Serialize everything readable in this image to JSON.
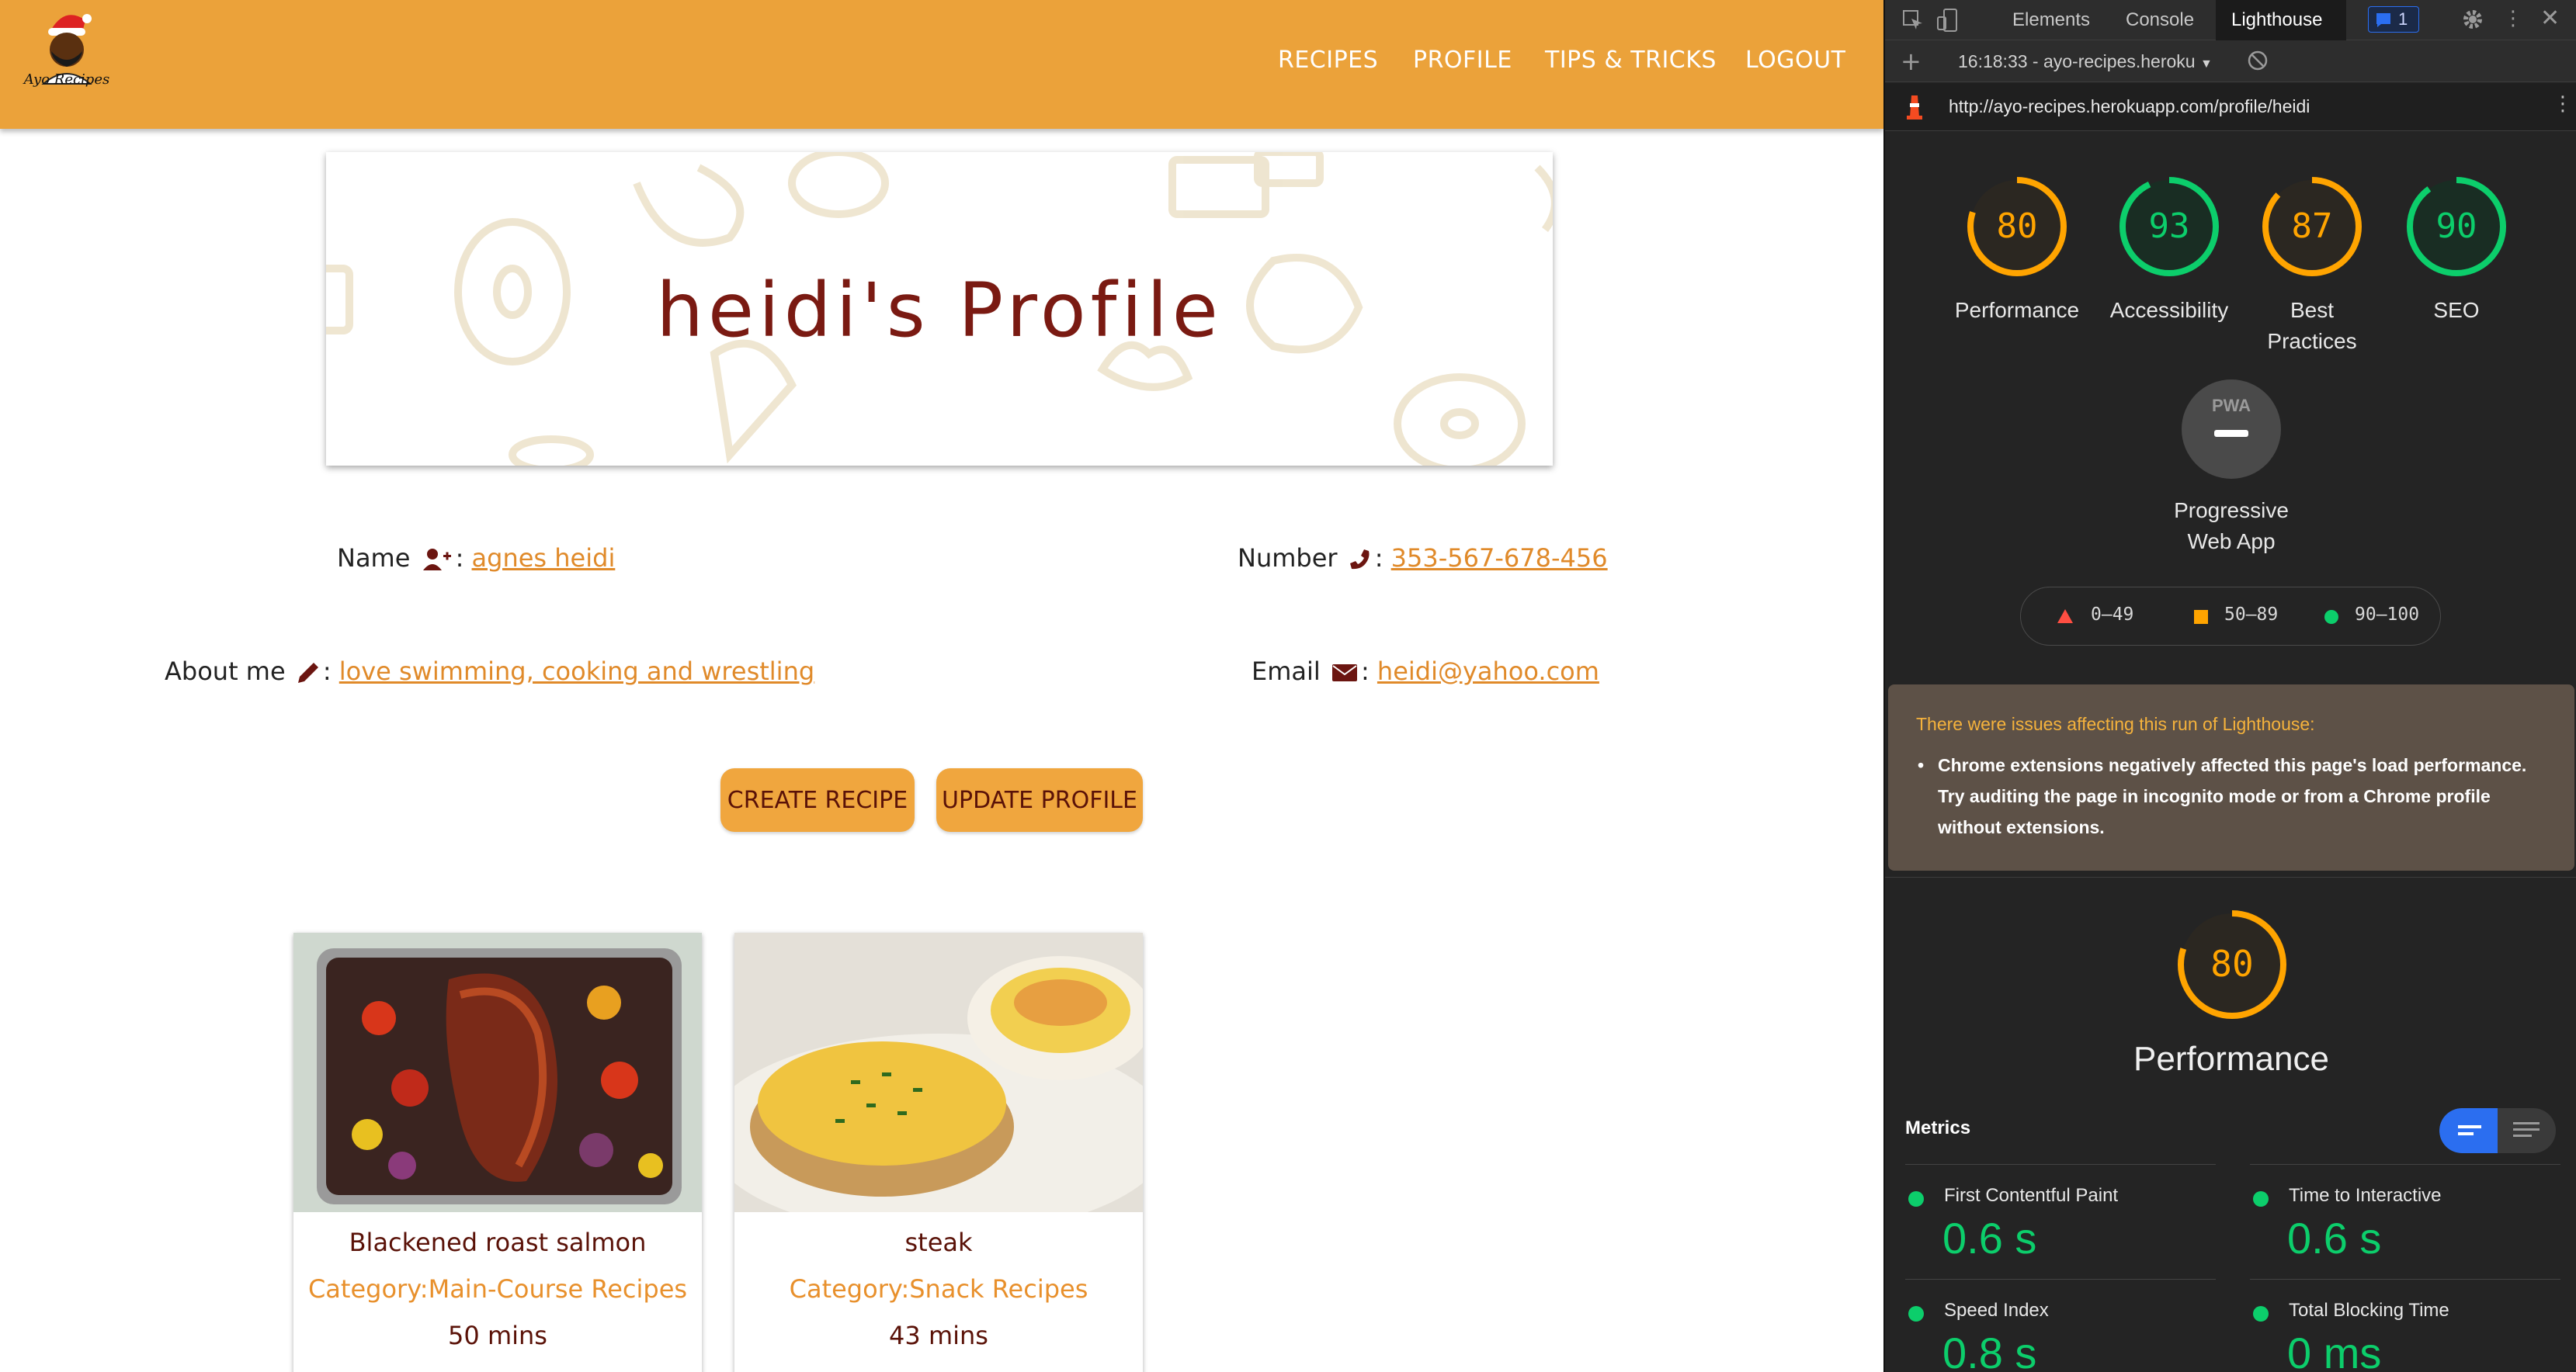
{
  "nav": {
    "logo_text": "Ayo Recipes",
    "links": [
      "RECIPES",
      "PROFILE",
      "TIPS & TRICKS",
      "LOGOUT"
    ]
  },
  "banner": {
    "title": "heidi's Profile"
  },
  "profile": {
    "name_label": "Name",
    "name_value": "agnes heidi",
    "number_label": "Number",
    "number_value": "353-567-678-456",
    "about_label": "About me",
    "about_value": "love swimming, cooking and wrestling",
    "email_label": "Email",
    "email_value": "heidi@yahoo.com",
    "colon": ":"
  },
  "buttons": {
    "create": "CREATE RECIPE",
    "update": "UPDATE PROFILE"
  },
  "recipes": [
    {
      "title": "Blackened roast salmon",
      "category": "Category:Main-Course Recipes",
      "time": "50 mins"
    },
    {
      "title": "steak",
      "category": "Category:Snack Recipes",
      "time": "43 mins"
    }
  ],
  "devtools": {
    "tabs": [
      "Elements",
      "Console",
      "Lighthouse"
    ],
    "active_tab": "Lighthouse",
    "issues_count": "1",
    "report_selector": "16:18:33 - ayo-recipes.heroku",
    "url": "http://ayo-recipes.herokuapp.com/profile/heidi",
    "scores": [
      {
        "score": "80",
        "label": "Performance",
        "color": "#ffa400"
      },
      {
        "score": "93",
        "label": "Accessibility",
        "color": "#0cce6b"
      },
      {
        "score": "87",
        "label": "Best Practices",
        "color": "#ffa400"
      },
      {
        "score": "90",
        "label": "SEO",
        "color": "#0cce6b"
      }
    ],
    "pwa_label": "Progressive Web App",
    "pwa_badge": "PWA",
    "legend": [
      "0–49",
      "50–89",
      "90–100"
    ],
    "legend_colors": {
      "fail": "#ff4e42",
      "average": "#ffa400",
      "pass": "#0cce6b"
    },
    "warning_title": "There were issues affecting this run of Lighthouse:",
    "warning_body": "Chrome extensions negatively affected this page's load performance. Try auditing the page in incognito mode or from a Chrome profile without extensions.",
    "performance_score": "80",
    "performance_label": "Performance",
    "metrics_title": "Metrics",
    "metrics": [
      {
        "label": "First Contentful Paint",
        "value": "0.6 s"
      },
      {
        "label": "Time to Interactive",
        "value": "0.6 s"
      },
      {
        "label": "Speed Index",
        "value": "0.8 s"
      },
      {
        "label": "Total Blocking Time",
        "value": "0 ms"
      }
    ]
  },
  "colors": {
    "nav_bg": "#eba23a",
    "title_red": "#7a1a12",
    "link_orange": "#e08a2a",
    "button_bg": "#f0a63e",
    "devtools_bg": "#242424"
  }
}
